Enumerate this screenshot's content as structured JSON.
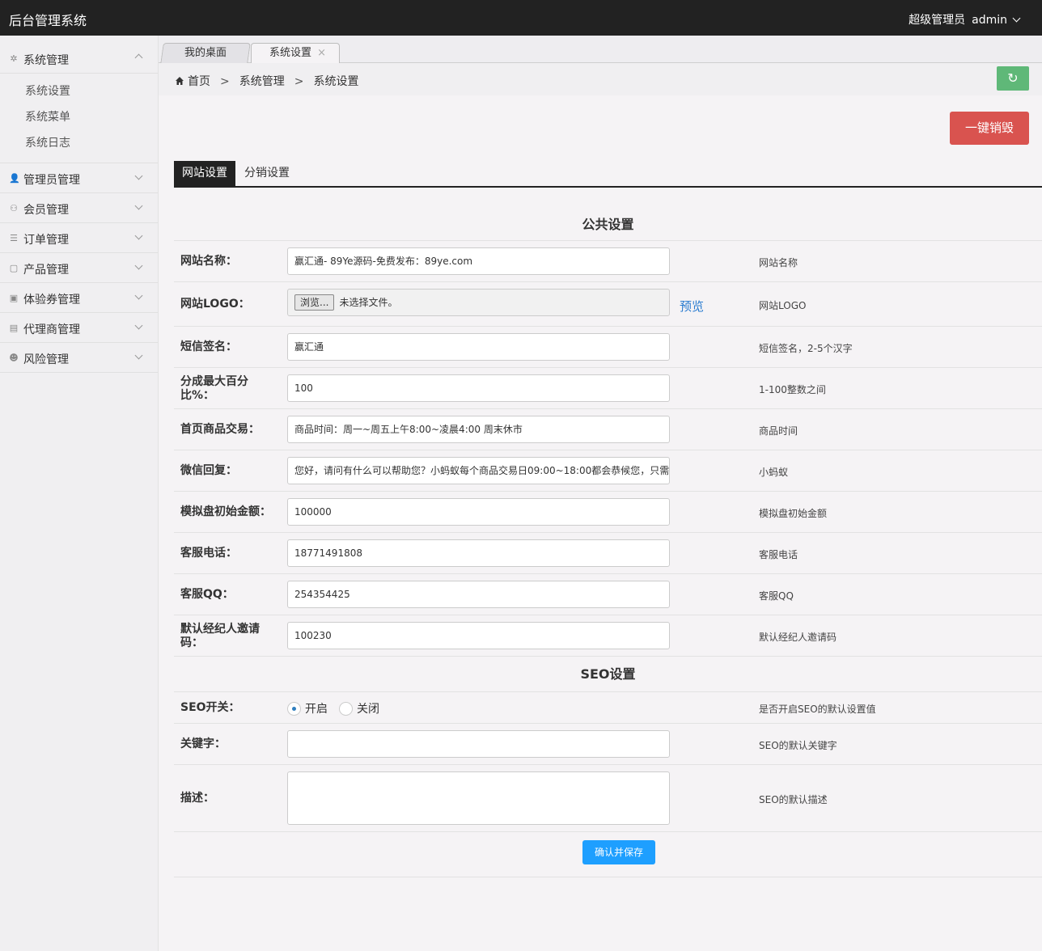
{
  "app": {
    "title": "后台管理系统",
    "role": "超级管理员",
    "username": "admin"
  },
  "sidebar": {
    "open_menu": {
      "label": "系统管理",
      "icon": "gear-icon",
      "items": [
        {
          "label": "系统设置"
        },
        {
          "label": "系统菜单"
        },
        {
          "label": "系统日志"
        }
      ]
    },
    "menus": [
      {
        "label": "管理员管理",
        "icon": "user-icon"
      },
      {
        "label": "会员管理",
        "icon": "member-icon"
      },
      {
        "label": "订单管理",
        "icon": "order-icon"
      },
      {
        "label": "产品管理",
        "icon": "bag-icon"
      },
      {
        "label": "体验券管理",
        "icon": "image-icon"
      },
      {
        "label": "代理商管理",
        "icon": "agent-icon"
      },
      {
        "label": "风险管理",
        "icon": "risk-icon"
      }
    ]
  },
  "tabs": [
    {
      "label": "我的桌面"
    },
    {
      "label": "系统设置",
      "close": "×"
    }
  ],
  "breadcrumb": {
    "items": [
      "首页",
      "系统管理",
      "系统设置"
    ],
    "sep": ">"
  },
  "actions": {
    "destroy": "一键销毁",
    "save": "确认并保存"
  },
  "settings_tabs": [
    "网站设置",
    "分销设置"
  ],
  "sections": {
    "public": "公共设置",
    "seo": "SEO设置"
  },
  "fields": [
    {
      "label": "网站名称：",
      "value": "赢汇通- 89Ye源码-免费发布：89ye.com",
      "desc": "网站名称"
    },
    {
      "label": "网站LOGO：",
      "file_button": "浏览...",
      "file_text": "未选择文件。",
      "preview": "预览",
      "desc": "网站LOGO"
    },
    {
      "label": "短信签名：",
      "value": "赢汇通",
      "desc": "短信签名，2-5个汉字"
    },
    {
      "label": "分成最大百分比%：",
      "value": "100",
      "desc": "1-100整数之间"
    },
    {
      "label": "首页商品交易：",
      "value": "商品时间：周一~周五上午8:00~凌晨4:00 周末休市",
      "desc": "商品时间"
    },
    {
      "label": "微信回复：",
      "value": "您好，请问有什么可以帮助您？小蚂蚁每个商品交易日09:00~18:00都会恭候您，只需",
      "desc": "小蚂蚁"
    },
    {
      "label": "模拟盘初始金额：",
      "value": "100000",
      "desc": "模拟盘初始金额"
    },
    {
      "label": "客服电话：",
      "value": "18771491808",
      "desc": "客服电话"
    },
    {
      "label": "客服QQ：",
      "value": "254354425",
      "desc": "客服QQ"
    },
    {
      "label": "默认经纪人邀请码：",
      "value": "100230",
      "desc": "默认经纪人邀请码"
    }
  ],
  "seo": {
    "switch": {
      "label": "SEO开关：",
      "on": "开启",
      "off": "关闭",
      "desc": "是否开启SEO的默认设置值"
    },
    "keywords": {
      "label": "关键字：",
      "value": "",
      "desc": "SEO的默认关键字"
    },
    "description": {
      "label": "描述：",
      "value": "",
      "desc": "SEO的默认描述"
    }
  },
  "colors": {
    "topbar": "#222222",
    "danger": "#d9534f",
    "primary": "#1e9fff",
    "refresh": "#5fb878"
  }
}
